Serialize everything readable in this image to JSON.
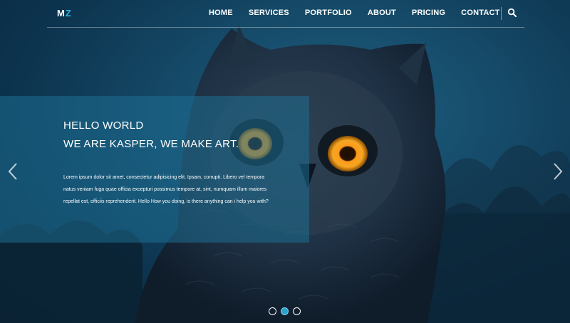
{
  "brand": {
    "logo_prefix": "M",
    "logo_suffix": "Z"
  },
  "nav": {
    "items": [
      {
        "label": "HOME"
      },
      {
        "label": "SERVICES"
      },
      {
        "label": "PORTFOLIO"
      },
      {
        "label": "ABOUT"
      },
      {
        "label": "PRICING"
      },
      {
        "label": "CONTACT"
      }
    ],
    "search_icon": "search-icon"
  },
  "hero": {
    "heading_1": "HELLO WORLD",
    "heading_2": "WE ARE KASPER, WE MAKE ART.",
    "paragraph": "Lorem ipsum dolor sit amet, consectetur adipisicing elit. Ipsam, corrupti. Libero vel tempora natus veniam fuga quae officia excepturi possimus tempore at, sint, numquam illum maiores repellat est, officiis reprehenderit. Hello How you doing, is there anything can i help you with?",
    "prev_icon": "chevron-left-icon",
    "next_icon": "chevron-right-icon"
  },
  "slider": {
    "dot_count": 3,
    "active_dot": 2
  },
  "colors": {
    "accent": "#2bb6df",
    "overlay": "#1e6e91",
    "eye": "#f5a623"
  }
}
